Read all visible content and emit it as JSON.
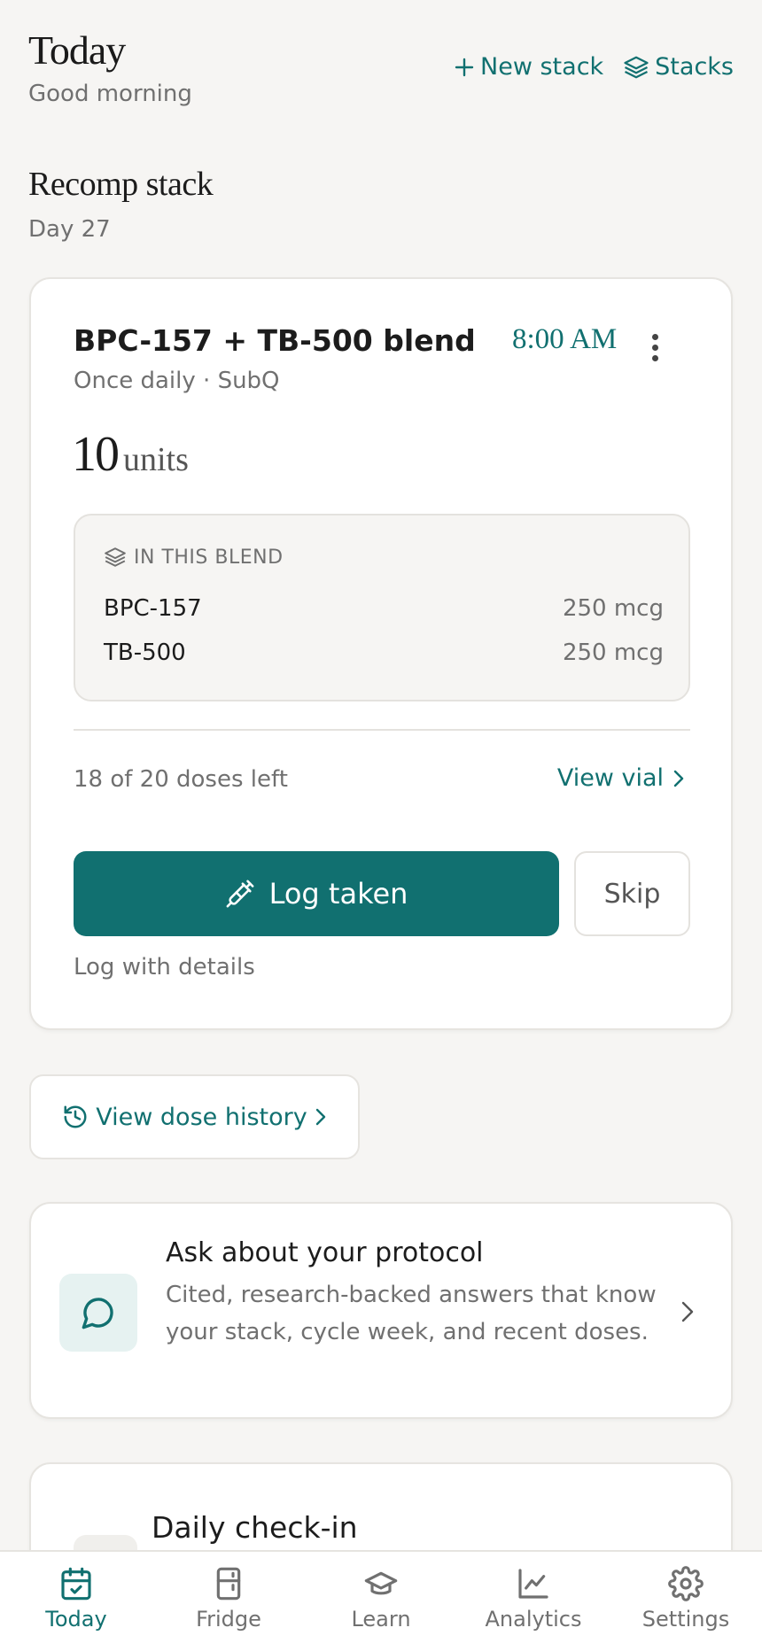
{
  "header": {
    "title": "Today",
    "greeting": "Good morning",
    "new_stack_label": "New stack",
    "stacks_label": "Stacks"
  },
  "stack": {
    "name": "Recomp stack",
    "day": "Day 27"
  },
  "dose": {
    "name": "BPC-157 + TB-500 blend",
    "time": "8:00 AM",
    "frequency": "Once daily · SubQ",
    "amount": "10",
    "unit": "units",
    "blend_header": "IN THIS BLEND",
    "blend": [
      {
        "name": "BPC-157",
        "amount": "250 mcg"
      },
      {
        "name": "TB-500",
        "amount": "250 mcg"
      }
    ],
    "doses_left": "18 of 20 doses left",
    "view_vial_label": "View vial",
    "log_taken_label": "Log taken",
    "skip_label": "Skip",
    "log_details_label": "Log with details"
  },
  "history": {
    "label": "View dose history"
  },
  "ask": {
    "title": "Ask about your protocol",
    "description": "Cited, research-backed answers that know your stack, cycle week, and recent doses."
  },
  "checkin": {
    "title": "Daily check-in"
  },
  "nav": {
    "items": [
      {
        "label": "Today",
        "icon": "calendar-check-icon",
        "active": true
      },
      {
        "label": "Fridge",
        "icon": "fridge-icon"
      },
      {
        "label": "Learn",
        "icon": "graduation-cap-icon"
      },
      {
        "label": "Analytics",
        "icon": "line-chart-icon"
      },
      {
        "label": "Settings",
        "icon": "gear-icon"
      }
    ]
  },
  "colors": {
    "accent": "#117070",
    "background": "#f6f5f3",
    "muted_text": "#707070"
  }
}
